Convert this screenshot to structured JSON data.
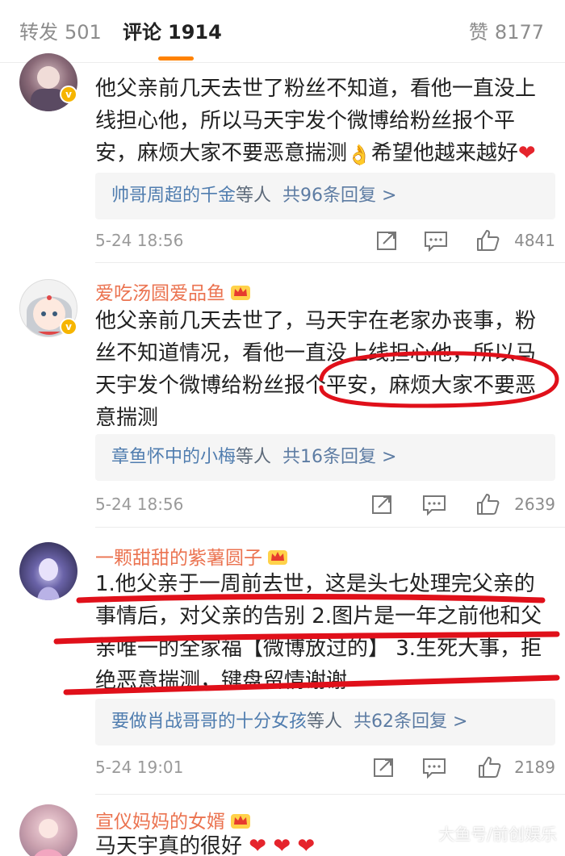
{
  "tabs": [
    {
      "label": "转发",
      "count": "501"
    },
    {
      "label": "评论",
      "count": "1914"
    },
    {
      "label": "赞",
      "count": "8177"
    }
  ],
  "comments": [
    {
      "username": "",
      "verified": true,
      "text": "他父亲前几天去世了粉丝不知道，看他一直没上线担心他，所以马天宇发个微博给粉丝报个平安，麻烦大家不要恶意揣测",
      "text_tail": "希望他越来越好",
      "emoji": "👌",
      "end_emoji": "❤",
      "reply_names": "帅哥周超的千金",
      "reply_mid": "等人",
      "reply_count": "共96条回复 >",
      "time": "5-24 18:56",
      "likes": "4841"
    },
    {
      "username": "爱吃汤圆爱品鱼",
      "verified": true,
      "text": "他父亲前几天去世了，马天宇在老家办丧事，粉丝不知道情况，看他一直没上线担心他，所以马天宇发个微博给粉丝报个平安，麻烦大家不要恶意揣测",
      "emoji": "👌",
      "reply_names": "章鱼怀中的小梅",
      "reply_mid": "等人",
      "reply_count": "共16条回复 >",
      "time": "5-24 18:56",
      "likes": "2639"
    },
    {
      "username": "一颗甜甜的紫薯圆子",
      "verified": false,
      "text": "1.他父亲于一周前去世，这是头七处理完父亲的事情后，对父亲的告别 2.图片是一年之前他和父亲唯一的全家福【微博放过的】 3.生死大事，拒绝恶意揣测，键盘留情谢谢",
      "reply_names": "要做肖战哥哥的十分女孩",
      "reply_mid": "等人",
      "reply_count": "共62条回复 >",
      "time": "5-24 19:01",
      "likes": "2189"
    },
    {
      "username": "宣仪妈妈的女婿",
      "verified": false,
      "text": "马天宇真的很好",
      "hearts": "❤ ❤ ❤"
    }
  ],
  "watermark": "大鱼号/前创娱乐",
  "colors": {
    "username": "#eb7350",
    "link": "#507daf",
    "annotation": "#e0101a",
    "verified": "#f6b500",
    "tab_accent": "#ff8200"
  },
  "icons": [
    "share-icon",
    "comment-icon",
    "like-icon",
    "crown-badge-icon",
    "verified-badge-icon"
  ]
}
